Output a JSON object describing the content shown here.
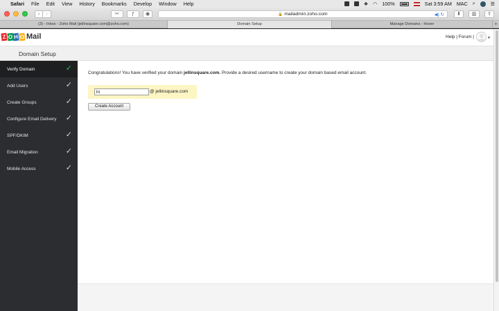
{
  "menubar": {
    "items": [
      "Safari",
      "File",
      "Edit",
      "View",
      "History",
      "Bookmarks",
      "Develop",
      "Window",
      "Help"
    ],
    "battery": "100%",
    "clock": "Sat 3:59 AM",
    "user": "MAC"
  },
  "toolbar": {
    "url": "mailadmin.zoho.com",
    "back": "‹",
    "forward": "›"
  },
  "tabs": [
    {
      "label": "(3) - Inbox - Zoho Mail (jellinsquare.com@zoho.com)"
    },
    {
      "label": "Domain Setup"
    },
    {
      "label": "Manage Domains - Hover"
    }
  ],
  "header": {
    "logo_letters": [
      "Z",
      "O",
      "H",
      "O"
    ],
    "logo_colors": [
      "#e42527",
      "#089949",
      "#226db4",
      "#f9b21d"
    ],
    "logo_mail": "Mail",
    "links": "Help | Forum |"
  },
  "subheader": {
    "title": "Domain Setup"
  },
  "sidebar": {
    "items": [
      {
        "label": "Verify Domain"
      },
      {
        "label": "Add Users"
      },
      {
        "label": "Create Groups"
      },
      {
        "label": "Configure Email Delivery"
      },
      {
        "label": "SPF/DKIM"
      },
      {
        "label": "Email Migration"
      },
      {
        "label": "Mobile Access"
      }
    ],
    "check": "✓"
  },
  "content": {
    "congrats_pre": "Congratulations! You have verified your domain ",
    "domain": "jellinsquare.com.",
    "congrats_post": " Provide a desired username to create your domain based email account.",
    "username_value": "hi",
    "domain_suffix": "@ jellinsquare.com",
    "create_button": "Create Account"
  },
  "colors": {
    "sidebar_bg": "#2b2d30",
    "active_check": "#22c45e",
    "form_highlight": "#fdf5c4"
  }
}
